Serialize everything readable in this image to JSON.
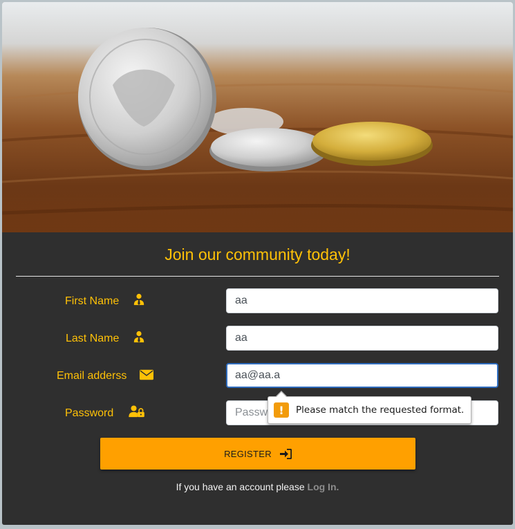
{
  "form": {
    "title": "Join our community today!",
    "fields": [
      {
        "label": "First Name",
        "icon": "user-tie-icon",
        "value": "aa",
        "placeholder": ""
      },
      {
        "label": "Last Name",
        "icon": "user-tie-icon",
        "value": "aa",
        "placeholder": ""
      },
      {
        "label": "Email adderss",
        "icon": "envelope-icon",
        "value": "aa@aa.a",
        "placeholder": ""
      },
      {
        "label": "Password",
        "icon": "user-lock-icon",
        "value": "",
        "placeholder": "Password"
      }
    ],
    "register_label": "REGISTER",
    "register_icon": "sign-in-icon",
    "footer_text": "If you have an account please ",
    "login_link": "Log In."
  },
  "validation_tooltip": {
    "icon": "warning-icon",
    "message": "Please match the requested format."
  },
  "colors": {
    "accent": "#ffc107",
    "button": "#ffa000",
    "panel": "#2f2f2f",
    "focus_border": "#2f6dbf",
    "link": "#8c8c8c"
  }
}
